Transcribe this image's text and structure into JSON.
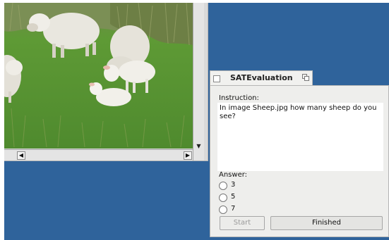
{
  "viewer": {
    "image_alt": "Sheep.jpg",
    "scroll_left_glyph": "◀",
    "scroll_right_glyph": "▶",
    "scroll_down_glyph": "▼"
  },
  "dialog": {
    "title": "SATEvaluation",
    "instruction_label": "Instruction:",
    "instruction_text": "In image Sheep.jpg how many sheep do you see?",
    "answer_label": "Answer:",
    "options": [
      "3",
      "5",
      "7"
    ],
    "start_label": "Start",
    "finished_label": "Finished"
  },
  "colors": {
    "desktop": "#2f639b",
    "dialog_bg": "#eeeeec",
    "grass": "#4f8a2e"
  }
}
